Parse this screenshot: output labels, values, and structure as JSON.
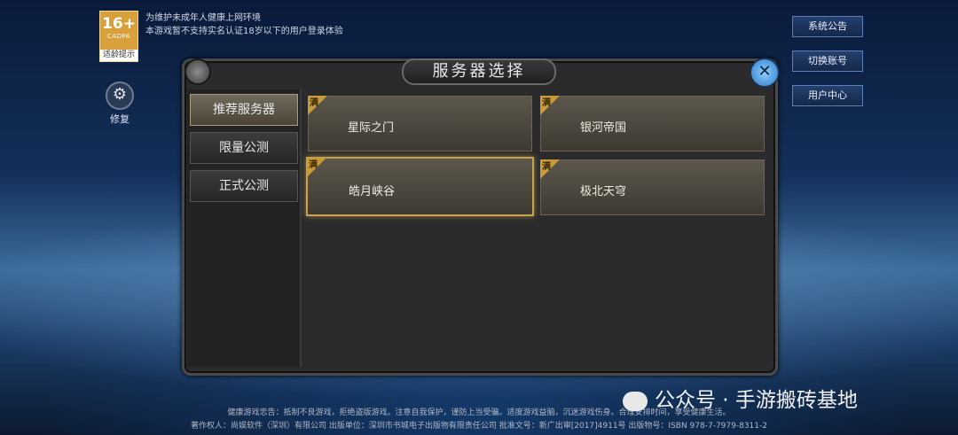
{
  "age_rating": {
    "number": "16+",
    "org": "CADPA",
    "tip": "适龄提示"
  },
  "notice": {
    "line1": "为维护未成年人健康上网环境",
    "line2": "本游戏暂不支持实名认证18岁以下的用户登录体验"
  },
  "repair": {
    "label": "修复",
    "icon": "gear-wrench-icon"
  },
  "side_buttons": [
    {
      "label": "系统公告"
    },
    {
      "label": "切换账号"
    },
    {
      "label": "用户中心"
    }
  ],
  "panel": {
    "title": "服务器选择"
  },
  "categories": [
    {
      "label": "推荐服务器",
      "active": true
    },
    {
      "label": "限量公测",
      "active": false
    },
    {
      "label": "正式公测",
      "active": false
    }
  ],
  "servers": [
    {
      "name": "星际之门",
      "tag": "满"
    },
    {
      "name": "银河帝国",
      "tag": "满"
    },
    {
      "name": "皓月峡谷",
      "tag": "满",
      "selected": true
    },
    {
      "name": "极北天穹",
      "tag": "满"
    }
  ],
  "footer": {
    "line1": "健康游戏忠告：抵制不良游戏，拒绝盗版游戏。注意自我保护，谨防上当受骗。适度游戏益脑，沉迷游戏伤身。合理安排时间，享受健康生活。",
    "line2": "著作权人：尚娱软件（深圳）有限公司 出版单位：深圳市书城电子出版物有限责任公司 批准文号：新广出审[2017]4911号 出版物号：ISBN 978-7-7979-8311-2"
  },
  "watermark": {
    "text": "公众号 · 手游搬砖基地"
  },
  "colors": {
    "accent_gold": "#c89a38",
    "side_button_border": "#5b7fb5",
    "badge_orange": "#d8a03a"
  }
}
